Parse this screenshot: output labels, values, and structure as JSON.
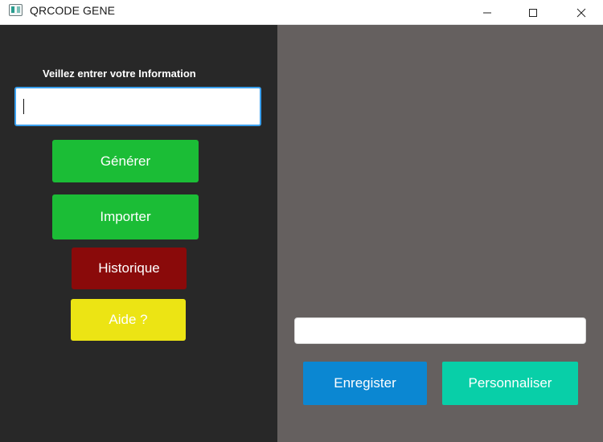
{
  "window": {
    "title": "QRCODE GENE",
    "icon": "app-window-icon",
    "controls": [
      "minimize-icon",
      "maximize-icon",
      "close-icon"
    ]
  },
  "left_panel": {
    "prompt_label": "Veillez entrer votre Information",
    "info_input_value": "",
    "buttons": {
      "generer": "Générer",
      "importer": "Importer",
      "historique": "Historique",
      "aide": "Aide ?"
    }
  },
  "right_panel": {
    "output_value": "",
    "buttons": {
      "enregister": "Enregister",
      "personnaliser": "Personnaliser"
    }
  },
  "colors": {
    "left_bg": "#282828",
    "right_bg": "#65605f",
    "green": "#1bbd36",
    "dark_red": "#8a0a0a",
    "yellow": "#ece414",
    "blue": "#0b87d2",
    "teal": "#08cfa8",
    "focus_border": "#3aa0ee"
  }
}
